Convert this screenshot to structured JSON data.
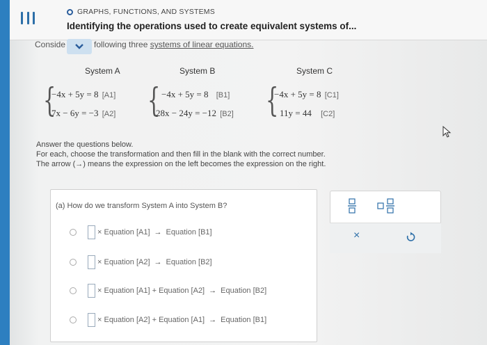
{
  "header": {
    "breadcrumb": "GRAPHS, FUNCTIONS, AND SYSTEMS",
    "title": "Identifying the operations used to create equivalent systems of..."
  },
  "intro": {
    "prefix": "Conside",
    "post_text": "following three ",
    "link_text": "systems of linear equations."
  },
  "systems": {
    "a": {
      "label": "System A",
      "eq1": "−4x + 5y = 8",
      "tag1": "[A1]",
      "eq2": "7x − 6y = −3",
      "tag2": "[A2]"
    },
    "b": {
      "label": "System B",
      "eq1": "−4x + 5y = 8",
      "tag1": "[B1]",
      "eq2": "28x − 24y = −12",
      "tag2": "[B2]"
    },
    "c": {
      "label": "System C",
      "eq1": "−4x + 5y = 8",
      "tag1": "[C1]",
      "eq2": "11y = 44",
      "tag2": "[C2]"
    }
  },
  "instructions": {
    "line1": "Answer the questions below.",
    "line2": "For each, choose the transformation and then fill in the blank with the correct number.",
    "line3": "The arrow (→) means the expression on the left becomes the expression on the right."
  },
  "question": {
    "label": "(a)  How do we transform System A into System B?",
    "options": [
      {
        "left": "× Equation [A1]",
        "right": "Equation [B1]"
      },
      {
        "left": "× Equation [A2]",
        "right": "Equation [B2]"
      },
      {
        "left": "× Equation [A1] + Equation [A2]",
        "right": "Equation [B2]"
      },
      {
        "left": "× Equation [A2] + Equation [A1]",
        "right": "Equation [B1]"
      }
    ],
    "arrow": "→"
  },
  "tools": {
    "clear_label": "×"
  },
  "colors": {
    "accent": "#2d7fc0",
    "toolbar_bg": "#eef0f1"
  }
}
